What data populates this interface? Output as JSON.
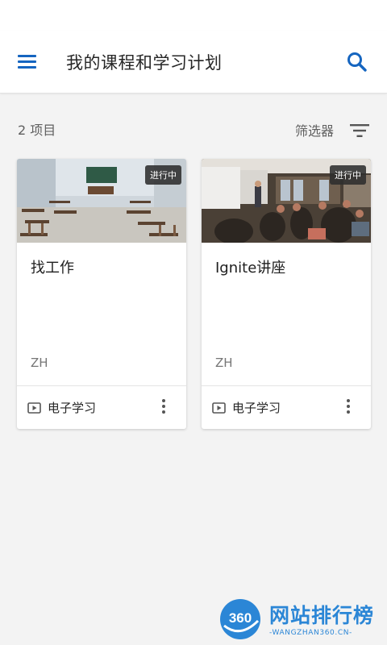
{
  "header": {
    "title": "我的课程和学习计划",
    "menu_icon": "hamburger-menu-icon",
    "search_icon": "search-icon",
    "accent_color": "#1565c0"
  },
  "toolbar": {
    "item_count": "2 项目",
    "filter_label": "筛选器",
    "filter_icon": "filter-icon"
  },
  "courses": [
    {
      "status": "进行中",
      "title": "找工作",
      "code": "ZH",
      "type": "电子学习",
      "type_icon": "video-play-icon",
      "thumbnail": "classroom-photo"
    },
    {
      "status": "进行中",
      "title": "Ignite讲座",
      "code": "ZH",
      "type": "电子学习",
      "type_icon": "video-play-icon",
      "thumbnail": "lecture-photo"
    }
  ],
  "watermark": {
    "logo_text": "360",
    "name": "网站排行榜",
    "url": "-WANGZHAN360.CN-"
  }
}
